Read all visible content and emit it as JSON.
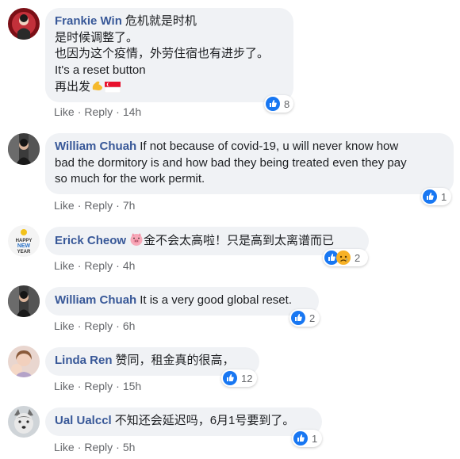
{
  "comments": [
    {
      "author": "Frankie Win",
      "lines": [
        "危机就是时机",
        "是时候调整了。",
        "也因为这个疫情，外劳住宿也有进步了。",
        "It's a reset button",
        "再出发"
      ],
      "reaction_count": "8",
      "like": "Like",
      "reply": "Reply",
      "time": "14h"
    },
    {
      "author": "William Chuah",
      "lines": [
        "If not because of covid-19, u will never know how",
        "bad the dormitory is and how bad they being treated even they pay",
        "so much for the work permit."
      ],
      "reaction_count": "1",
      "like": "Like",
      "reply": "Reply",
      "time": "7h"
    },
    {
      "author": "Erick Cheow",
      "text": "金不会太高啦！只是高到太离谱而已",
      "reaction_count": "2",
      "like": "Like",
      "reply": "Reply",
      "time": "4h"
    },
    {
      "author": "William Chuah",
      "text": "It is a very good global reset.",
      "reaction_count": "2",
      "like": "Like",
      "reply": "Reply",
      "time": "6h"
    },
    {
      "author": "Linda Ren",
      "text": "赞同，租金真的很高，",
      "reaction_count": "12",
      "like": "Like",
      "reply": "Reply",
      "time": "15h"
    },
    {
      "author": "Ual Ualccl",
      "text": "不知还会延迟吗，6月1号要到了。",
      "reaction_count": "1",
      "like": "Like",
      "reply": "Reply",
      "time": "5h"
    }
  ],
  "colors": {
    "author": "#385898",
    "meta": "#65676b",
    "bubble": "#f0f2f5",
    "like_blue": "#1877f2"
  },
  "icons": {
    "like": "thumbs-up-icon",
    "sad": "sad-face-icon",
    "pig": "pig-face-emoji",
    "muscle": "flexed-biceps-emoji",
    "flag": "singapore-flag-emoji",
    "separator": "·"
  }
}
